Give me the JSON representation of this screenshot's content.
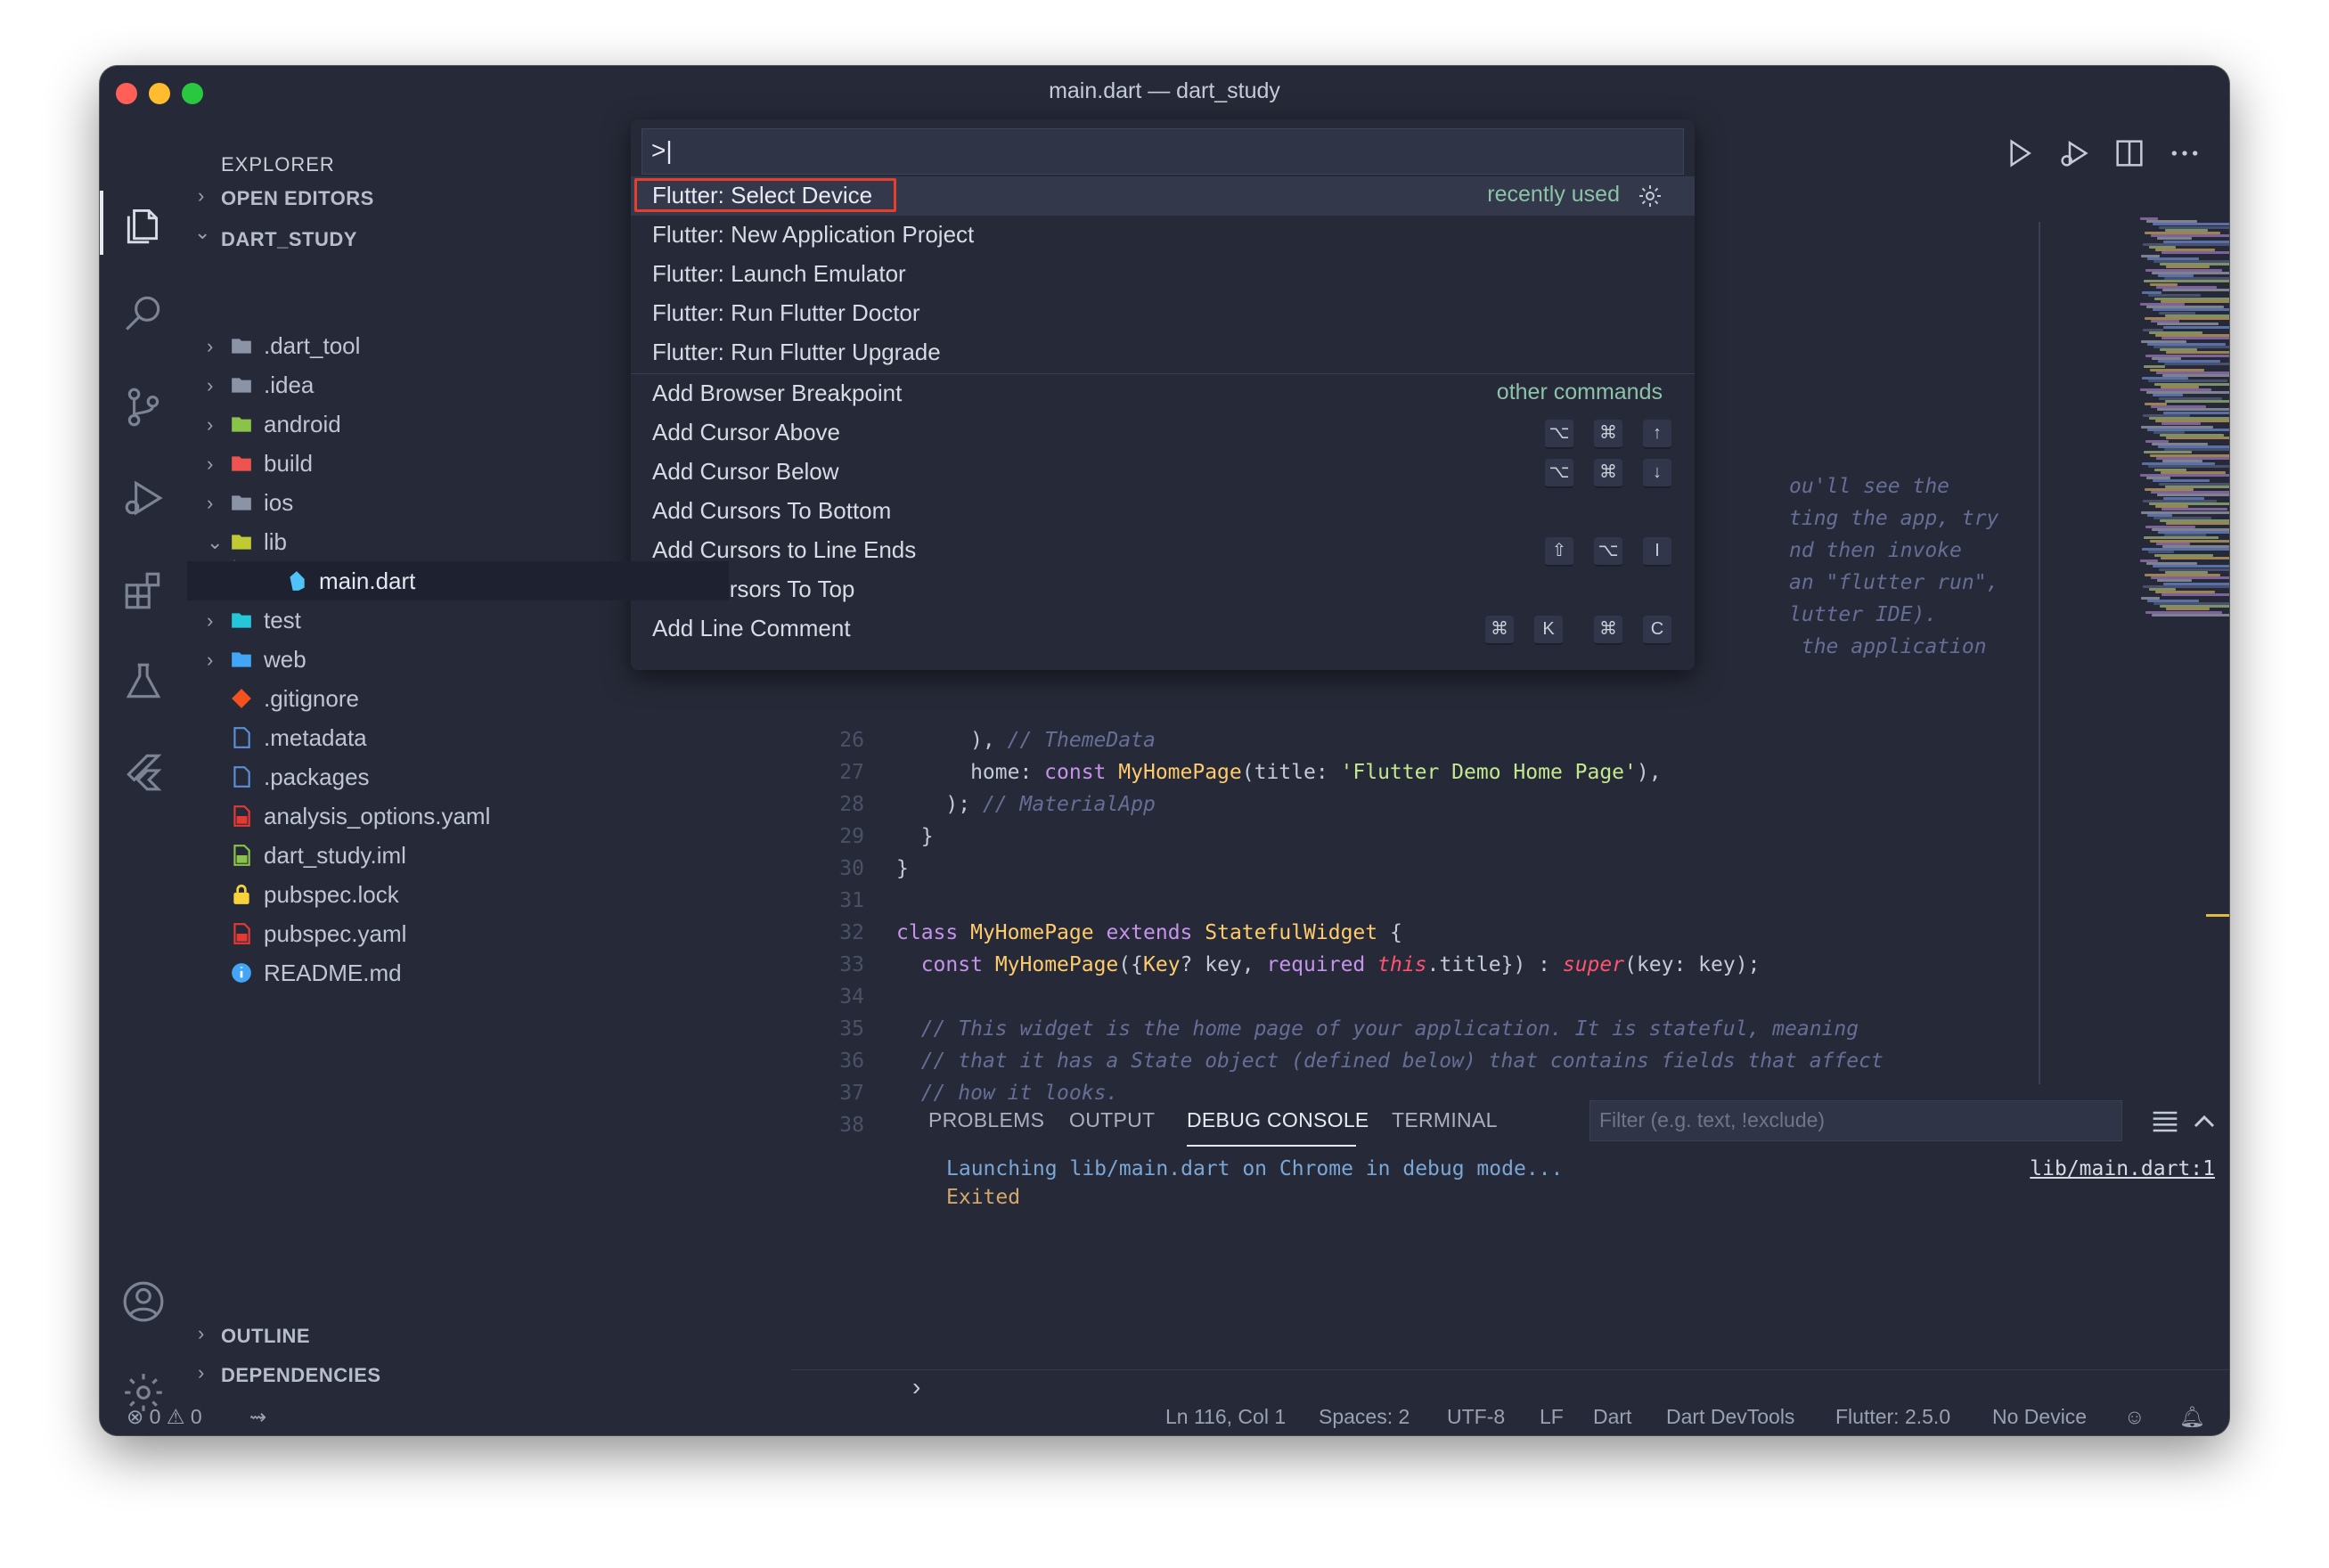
{
  "window": {
    "title": "main.dart — dart_study"
  },
  "sidebar": {
    "title": "EXPLORER",
    "open_editors": "OPEN EDITORS",
    "project": "DART_STUDY",
    "tree": [
      {
        "name": ".dart_tool",
        "icon": "folder-icon",
        "chevron": "›"
      },
      {
        "name": ".idea",
        "icon": "idea-folder-icon",
        "chevron": "›"
      },
      {
        "name": "android",
        "icon": "android-folder-icon",
        "chevron": "›"
      },
      {
        "name": "build",
        "icon": "build-folder-icon",
        "chevron": "›"
      },
      {
        "name": "ios",
        "icon": "ios-folder-icon",
        "chevron": "›"
      },
      {
        "name": "lib",
        "icon": "lib-folder-open-icon",
        "chevron": "⌄"
      },
      {
        "name": "main.dart",
        "icon": "dart-file-icon",
        "chevron": ""
      },
      {
        "name": "test",
        "icon": "test-folder-icon",
        "chevron": "›"
      },
      {
        "name": "web",
        "icon": "web-folder-icon",
        "chevron": "›"
      },
      {
        "name": ".gitignore",
        "icon": "git-icon",
        "chevron": ""
      },
      {
        "name": ".metadata",
        "icon": "file-icon",
        "chevron": ""
      },
      {
        "name": ".packages",
        "icon": "file-icon",
        "chevron": ""
      },
      {
        "name": "analysis_options.yaml",
        "icon": "yaml-file-icon",
        "chevron": ""
      },
      {
        "name": "dart_study.iml",
        "icon": "iml-file-icon",
        "chevron": ""
      },
      {
        "name": "pubspec.lock",
        "icon": "lock-icon",
        "chevron": ""
      },
      {
        "name": "pubspec.yaml",
        "icon": "yaml-file-icon",
        "chevron": ""
      },
      {
        "name": "README.md",
        "icon": "info-icon",
        "chevron": ""
      }
    ],
    "outline": "OUTLINE",
    "dependencies": "DEPENDENCIES"
  },
  "command_palette": {
    "input_value": ">|",
    "items": [
      {
        "label": "Flutter: Select Device",
        "tag": "recently used"
      },
      {
        "label": "Flutter: New Application Project"
      },
      {
        "label": "Flutter: Launch Emulator"
      },
      {
        "label": "Flutter: Run Flutter Doctor"
      },
      {
        "label": "Flutter: Run Flutter Upgrade"
      },
      {
        "label": "Add Browser Breakpoint",
        "tag": "other commands"
      },
      {
        "label": "Add Cursor Above",
        "keys": [
          "⌥",
          "⌘",
          "↑"
        ]
      },
      {
        "label": "Add Cursor Below",
        "keys": [
          "⌥",
          "⌘",
          "↓"
        ]
      },
      {
        "label": "Add Cursors To Bottom"
      },
      {
        "label": "Add Cursors to Line Ends",
        "keys": [
          "⇧",
          "⌥",
          "I"
        ]
      },
      {
        "label": "Add Cursors To Top"
      },
      {
        "label": "Add Line Comment",
        "keys": [
          "⌘",
          "K",
          "⌘",
          "C"
        ]
      }
    ]
  },
  "editor": {
    "partial_lines": [
      "ou'll see the",
      "ting the app, try",
      "nd then invoke",
      "an \"flutter run\",",
      "lutter IDE).",
      " the application"
    ],
    "lines": [
      {
        "n": "26",
        "text": "      ), // ThemeData"
      },
      {
        "n": "27",
        "text": "      home: const MyHomePage(title: 'Flutter Demo Home Page'),"
      },
      {
        "n": "28",
        "text": "    ); // MaterialApp"
      },
      {
        "n": "29",
        "text": "  }"
      },
      {
        "n": "30",
        "text": "}"
      },
      {
        "n": "31",
        "text": ""
      },
      {
        "n": "32",
        "text": "class MyHomePage extends StatefulWidget {"
      },
      {
        "n": "33",
        "text": "  const MyHomePage({Key? key, required this.title}) : super(key: key);"
      },
      {
        "n": "34",
        "text": ""
      },
      {
        "n": "35",
        "text": "  // This widget is the home page of your application. It is stateful, meaning"
      },
      {
        "n": "36",
        "text": "  // that it has a State object (defined below) that contains fields that affect"
      },
      {
        "n": "37",
        "text": "  // how it looks."
      },
      {
        "n": "38",
        "text": ""
      }
    ]
  },
  "panel": {
    "tabs": [
      "PROBLEMS",
      "OUTPUT",
      "DEBUG CONSOLE",
      "TERMINAL"
    ],
    "active_tab": "DEBUG CONSOLE",
    "filter_placeholder": "Filter (e.g. text, !exclude)",
    "console": [
      "Launching lib/main.dart on Chrome in debug mode...",
      "Exited"
    ],
    "link": "lib/main.dart:1",
    "prompt": "›"
  },
  "status": {
    "errors": "0",
    "warnings": "0",
    "position": "Ln 116, Col 1",
    "spaces": "Spaces: 2",
    "encoding": "UTF-8",
    "eol": "LF",
    "language": "Dart",
    "devtools": "Dart DevTools",
    "flutter": "Flutter: 2.5.0",
    "device": "No Device"
  },
  "colors": {
    "background": "#262a38",
    "accent_highlight": "#e5402f",
    "keyword": "#c792ea",
    "class": "#ffcb6b",
    "string": "#c3e88d",
    "comment": "#676e95"
  }
}
